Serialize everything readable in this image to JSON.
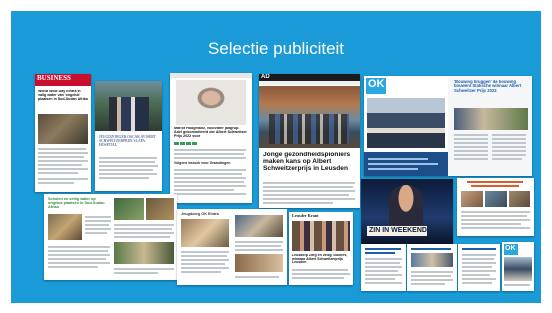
{
  "slide": {
    "title": "Selectie publiciteit"
  },
  "clippings": {
    "business": {
      "masthead": "BUSINESS",
      "headline": "World Wide Day Eintra in vallg water van 'ongeluk' plaatsen in Sud-Sudan Afrika"
    },
    "award_photo": {
      "caption": "JEUGDZORGER OSCAR AVISERT SCHWEITZERPRIJS SLAPA HOSPITAL"
    },
    "interview": {
      "headline": "Marlot Hoogmanz, voorzitter jaltgrup. Adel gekommiteerd der Albert Schweitzer Prijs 2022 voor",
      "subhead": "Volgens bezoek voor Gramdingen"
    },
    "ad_article": {
      "logo": "AD",
      "headline": "Jonge gezondheidspioniers maken kans op Albert Schweitzerprijs in Leusden"
    },
    "ok_magazine": {
      "logo": "OK",
      "headline": "'Bouwing bruggen' de bouwing bouwen! Statische winnaar Albert Schweitzer Prijs 2022"
    },
    "green_page": {
      "headline": "Scholen en veilig water op ongeluk plaatsen in Sud-Sudan Afrika"
    },
    "interview_page": {
      "headline": "Jeugdzorg OK Eintra"
    },
    "leusder_krant": {
      "masthead": "Leusder Krant",
      "headline": "Leusdorp Zorg en veilig 'Duikers, winnaar Albert Schweitzerprijs Leusden"
    },
    "video": {
      "banner": "ZIN IN WEEKEND"
    },
    "mini_pages": {
      "label": "OK"
    }
  }
}
